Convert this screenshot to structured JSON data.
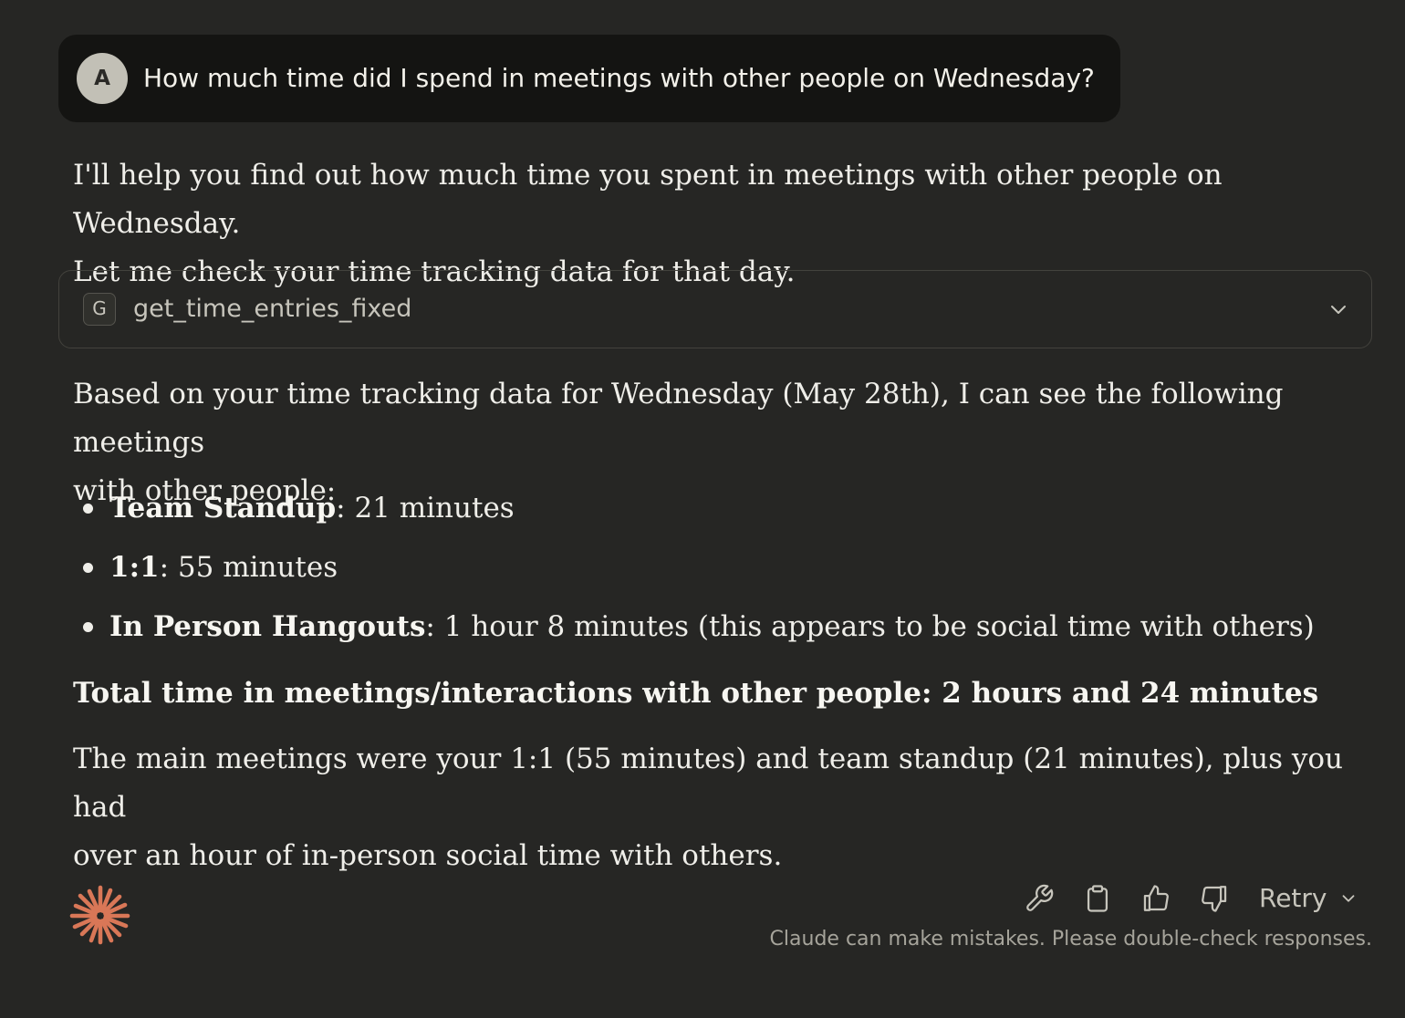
{
  "user_message": {
    "avatar_letter": "A",
    "text": "How much time did I spend in meetings with other people on Wednesday?"
  },
  "response": {
    "intro_line1": "I'll help you find out how much time you spent in meetings with other people on Wednesday.",
    "intro_line2": "Let me check your time tracking data for that day.",
    "tool": {
      "badge_letter": "G",
      "name": "get_time_entries_fixed",
      "chevron_icon": "chevron-down-icon"
    },
    "summary_line1": "Based on your time tracking data for Wednesday (May 28th), I can see the following meetings",
    "summary_line2": "with other people:",
    "meetings": [
      {
        "name": "Team Standup",
        "detail": ": 21 minutes"
      },
      {
        "name": "1:1",
        "detail": ": 55 minutes"
      },
      {
        "name": "In Person Hangouts",
        "detail": ": 1 hour 8 minutes (this appears to be social time with others)"
      }
    ],
    "total": "Total time in meetings/interactions with other people: 2 hours and 24 minutes",
    "closing_line1": "The main meetings were your 1:1 (55 minutes) and team standup (21 minutes), plus you had",
    "closing_line2": "over an hour of in-person social time with others."
  },
  "footer": {
    "logo_icon": "claude-sparkle-icon",
    "actions": {
      "tools_icon": "wrench-icon",
      "copy_icon": "clipboard-icon",
      "like_icon": "thumbs-up-icon",
      "dislike_icon": "thumbs-down-icon",
      "retry_label": "Retry"
    },
    "disclaimer": "Claude can make mistakes. Please double-check responses."
  },
  "colors": {
    "background": "#262624",
    "user_bubble": "#141412",
    "logo_accent": "#d97757"
  }
}
